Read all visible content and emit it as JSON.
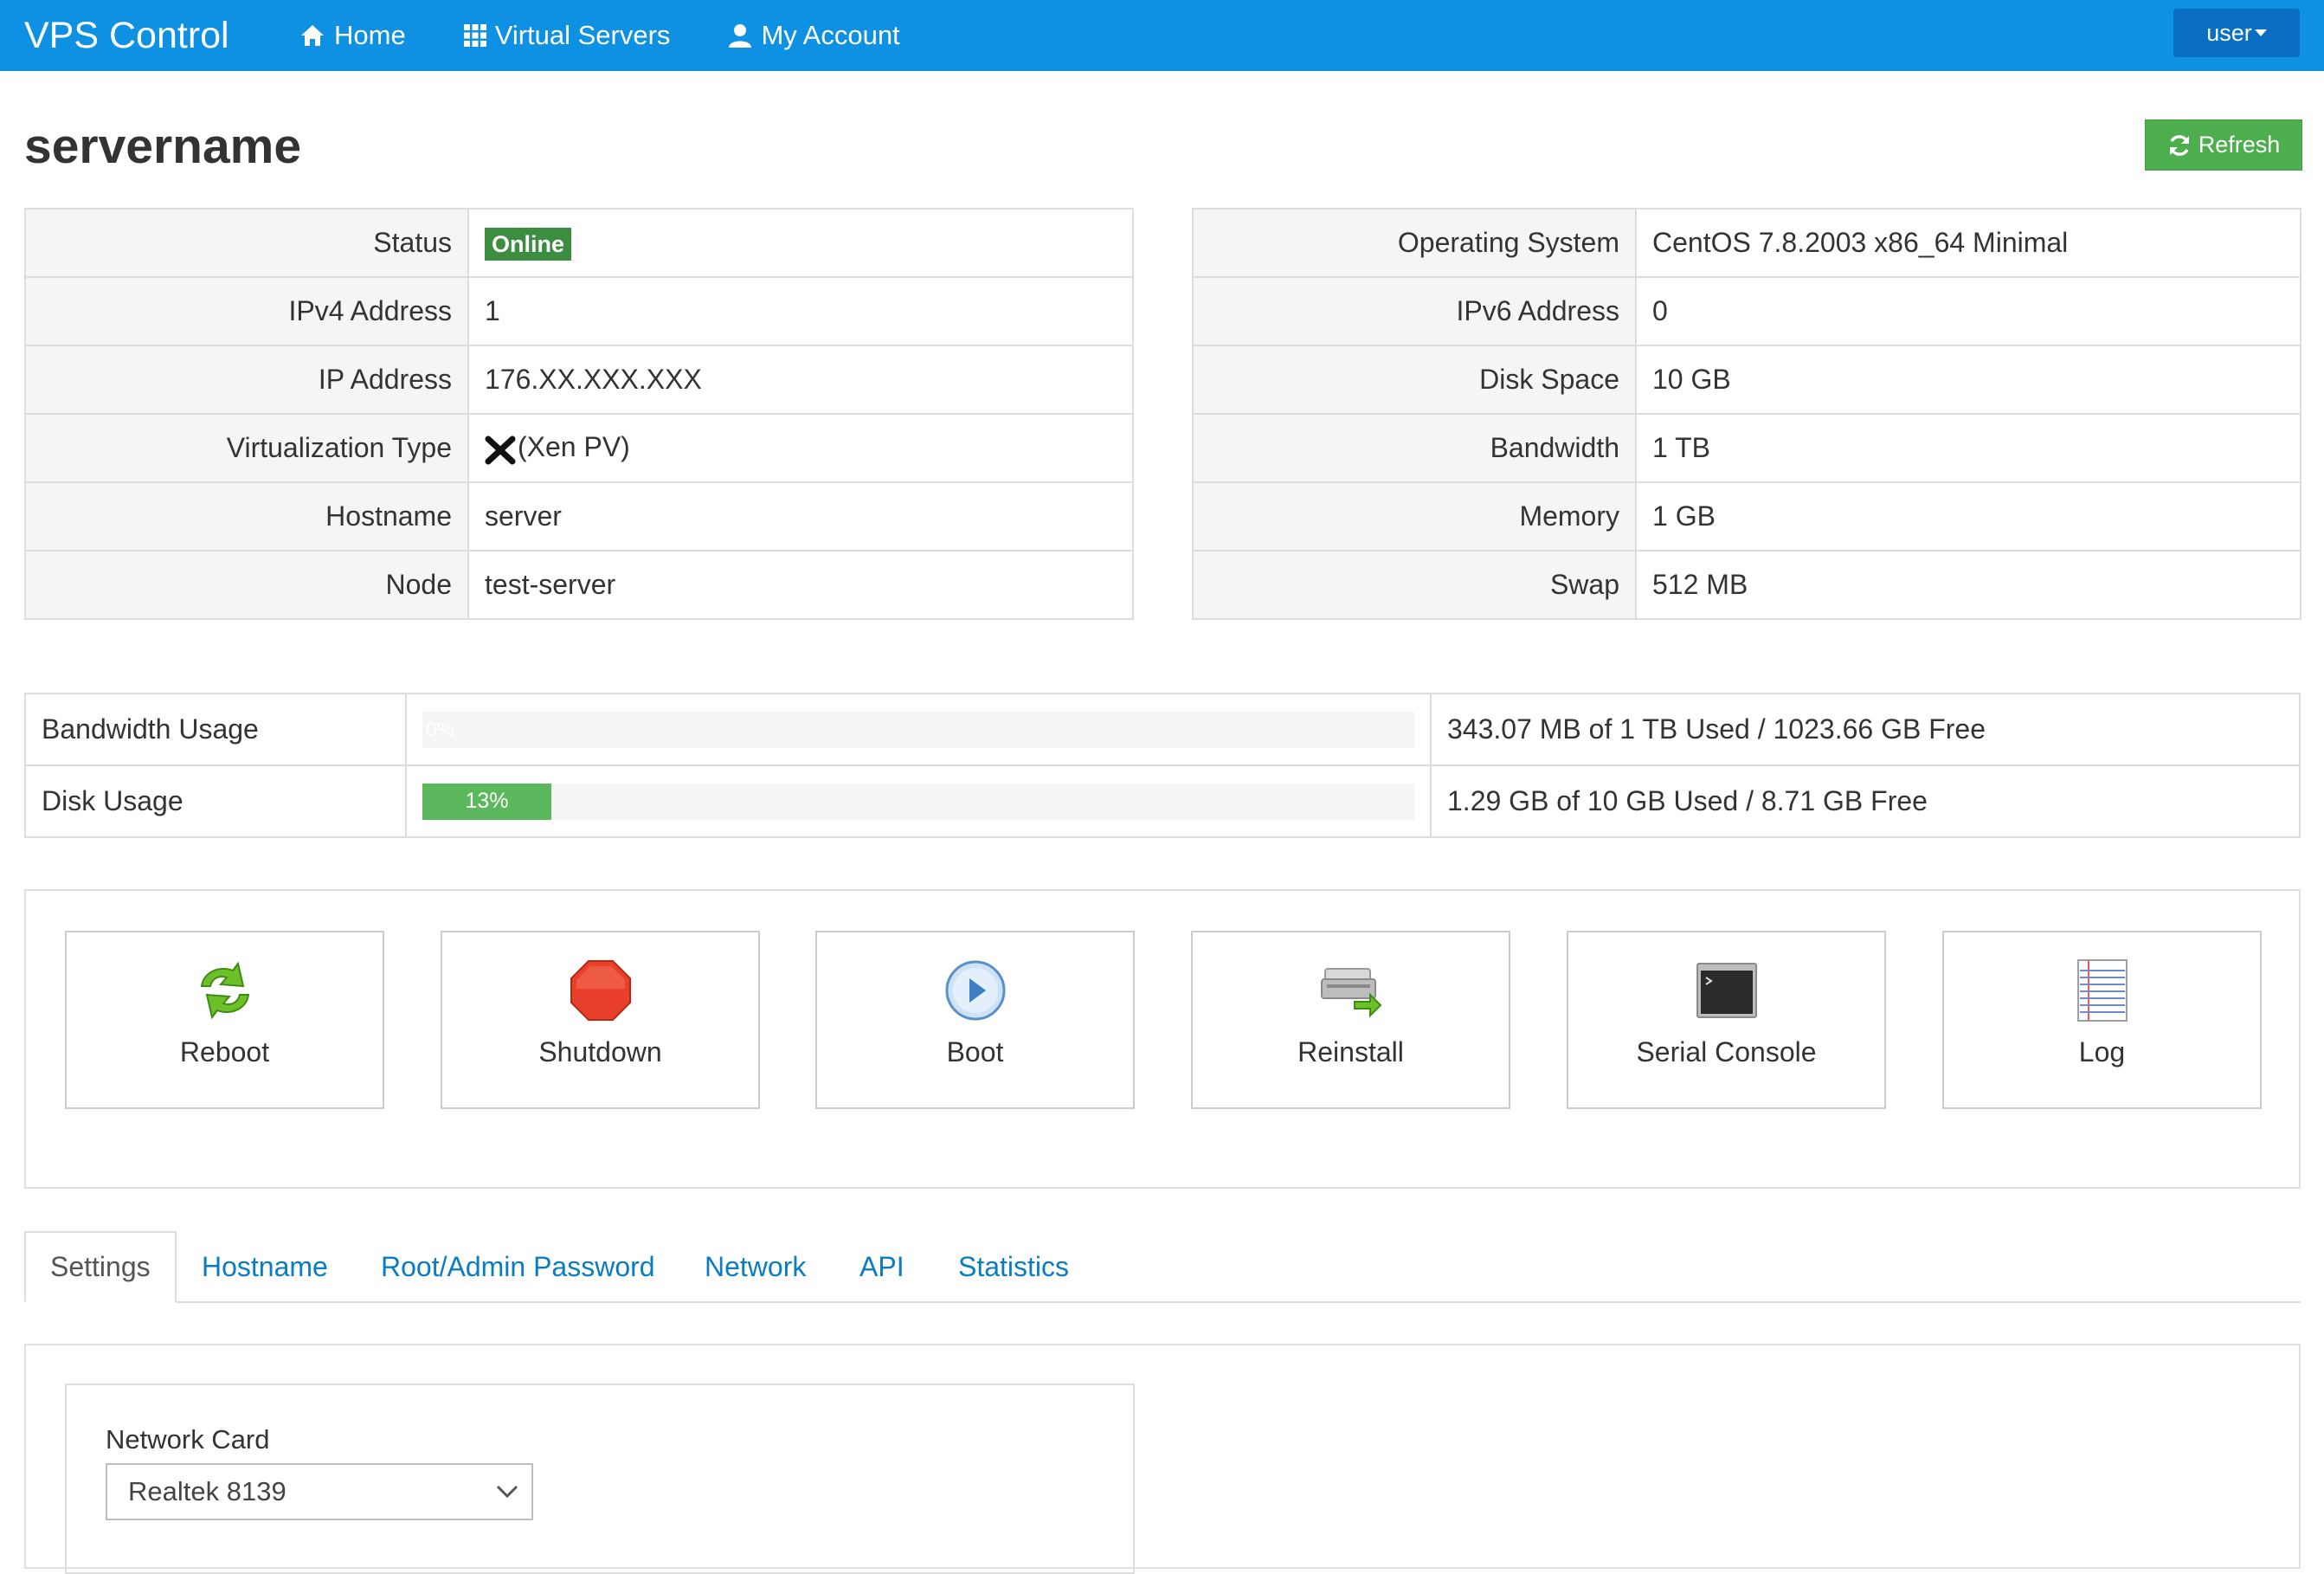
{
  "navbar": {
    "brand": "VPS Control",
    "items": [
      {
        "label": "Home",
        "icon": "home-icon"
      },
      {
        "label": "Virtual Servers",
        "icon": "grid-icon"
      },
      {
        "label": "My Account",
        "icon": "user-icon"
      }
    ],
    "user_menu": "user"
  },
  "page": {
    "title": "servername",
    "refresh_label": "Refresh"
  },
  "info_left": [
    {
      "label": "Status",
      "value": "Online"
    },
    {
      "label": "IPv4 Address",
      "value": "1"
    },
    {
      "label": "IP Address",
      "value": "176.XX.XXX.XXX"
    },
    {
      "label": "Virtualization Type",
      "value": "(Xen PV)"
    },
    {
      "label": "Hostname",
      "value": "server"
    },
    {
      "label": "Node",
      "value": "test-server"
    }
  ],
  "info_right": [
    {
      "label": "Operating System",
      "value": "CentOS 7.8.2003 x86_64 Minimal"
    },
    {
      "label": "IPv6 Address",
      "value": "0"
    },
    {
      "label": "Disk Space",
      "value": "10 GB"
    },
    {
      "label": "Bandwidth",
      "value": "1 TB"
    },
    {
      "label": "Memory",
      "value": "1 GB"
    },
    {
      "label": "Swap",
      "value": "512 MB"
    }
  ],
  "usage": [
    {
      "label": "Bandwidth Usage",
      "percent": 0,
      "percent_label": "0%",
      "summary": "343.07 MB of 1 TB Used / 1023.66 GB Free"
    },
    {
      "label": "Disk Usage",
      "percent": 13,
      "percent_label": "13%",
      "summary": "1.29 GB of 10 GB Used / 8.71 GB Free"
    }
  ],
  "actions": [
    {
      "label": "Reboot",
      "icon": "reboot-icon"
    },
    {
      "label": "Shutdown",
      "icon": "shutdown-icon"
    },
    {
      "label": "Boot",
      "icon": "boot-icon"
    },
    {
      "label": "Reinstall",
      "icon": "reinstall-icon"
    },
    {
      "label": "Serial Console",
      "icon": "serial-console-icon"
    },
    {
      "label": "Log",
      "icon": "log-icon"
    }
  ],
  "tabs": [
    "Settings",
    "Hostname",
    "Root/Admin Password",
    "Network",
    "API",
    "Statistics"
  ],
  "active_tab": "Settings",
  "settings": {
    "network_card_label": "Network Card",
    "network_card_value": "Realtek 8139"
  },
  "colors": {
    "navbar": "#0e90e3",
    "user_menu": "#0a6fc3",
    "success": "#5cb85c",
    "status_online": "#3c8d40",
    "link": "#0a7cc4"
  }
}
